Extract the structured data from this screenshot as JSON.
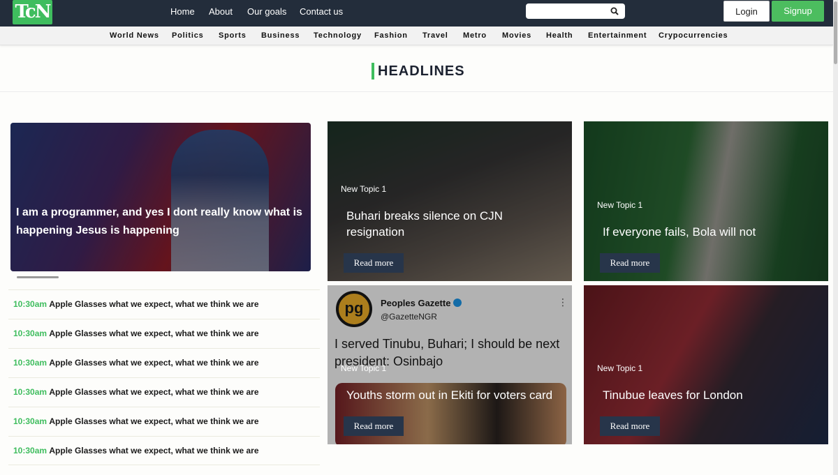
{
  "brand": {
    "logo_text": "TcN"
  },
  "nav": {
    "links": [
      "Home",
      "About",
      "Our goals",
      "Contact us"
    ]
  },
  "search": {
    "placeholder": ""
  },
  "auth": {
    "login_label": "Login",
    "signup_label": "Signup"
  },
  "categories": [
    "World News",
    "Politics",
    "Sports",
    "Business",
    "Technology",
    "Fashion",
    "Travel",
    "Metro",
    "Movies",
    "Health",
    "Entertainment",
    "Crypocurrencies"
  ],
  "headlines": {
    "title": "HEADLINES"
  },
  "hero": {
    "title": "I am a programmer, and yes I dont really know what is happening Jesus is happening"
  },
  "news_list": [
    {
      "time": "10:30am",
      "text": "Apple Glasses what we expect, what we think we are"
    },
    {
      "time": "10:30am",
      "text": "Apple Glasses what we expect, what we think we are"
    },
    {
      "time": "10:30am",
      "text": "Apple Glasses what we expect, what we think we are"
    },
    {
      "time": "10:30am",
      "text": "Apple Glasses what we expect, what we think we are"
    },
    {
      "time": "10:30am",
      "text": "Apple Glasses what we expect, what we think we are"
    },
    {
      "time": "10:30am",
      "text": "Apple Glasses what we expect, what we think we are"
    }
  ],
  "cards": [
    {
      "topic": "New Topic 1",
      "title": "Buhari breaks silence on CJN resignation",
      "button": "Read more"
    },
    {
      "topic": "New Topic 1",
      "title": "If everyone fails, Bola will not",
      "button": "Read more"
    },
    {
      "topic": "New Topic 1",
      "title": "Youths storm out in Ekiti for voters card",
      "button": "Read more"
    },
    {
      "topic": "New Topic 1",
      "title": "Tinubue leaves for London",
      "button": "Read more"
    }
  ],
  "tweet": {
    "avatar_text": "pg",
    "name": "Peoples Gazette",
    "handle": "@GazetteNGR",
    "text": "I served Tinubu, Buhari; I should be next president: Osinbajo"
  },
  "colors": {
    "accent": "#3fbd5e",
    "topbar": "#232d3b",
    "button_dark": "#27354a"
  }
}
